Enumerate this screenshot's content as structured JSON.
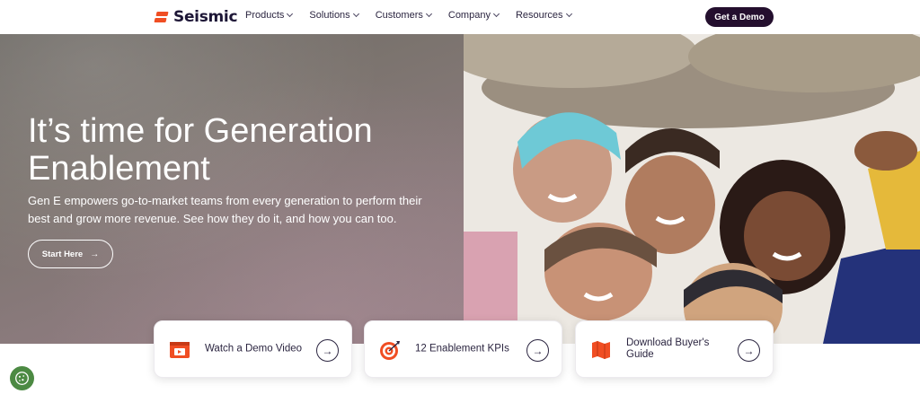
{
  "brand": {
    "name": "Seismic",
    "accent": "#f04e23",
    "dark": "#240f2e"
  },
  "nav": {
    "items": [
      {
        "label": "Products"
      },
      {
        "label": "Solutions"
      },
      {
        "label": "Customers"
      },
      {
        "label": "Company"
      },
      {
        "label": "Resources"
      }
    ],
    "cta_label": "Get a Demo"
  },
  "hero": {
    "title": "It’s time for Generation Enablement",
    "subtitle": "Gen E empowers go-to-market teams from every generation to perform their best and grow more revenue. See how they do it, and how you can too.",
    "button_label": "Start Here",
    "button_icon": "arrow-right-icon"
  },
  "cards": [
    {
      "label": "Watch a Demo Video",
      "icon": "video-player-icon"
    },
    {
      "label": "12 Enablement KPIs",
      "icon": "target-icon"
    },
    {
      "label": "Download Buyer's Guide",
      "icon": "map-icon"
    }
  ],
  "cookie": {
    "icon": "cookie-settings-icon"
  }
}
